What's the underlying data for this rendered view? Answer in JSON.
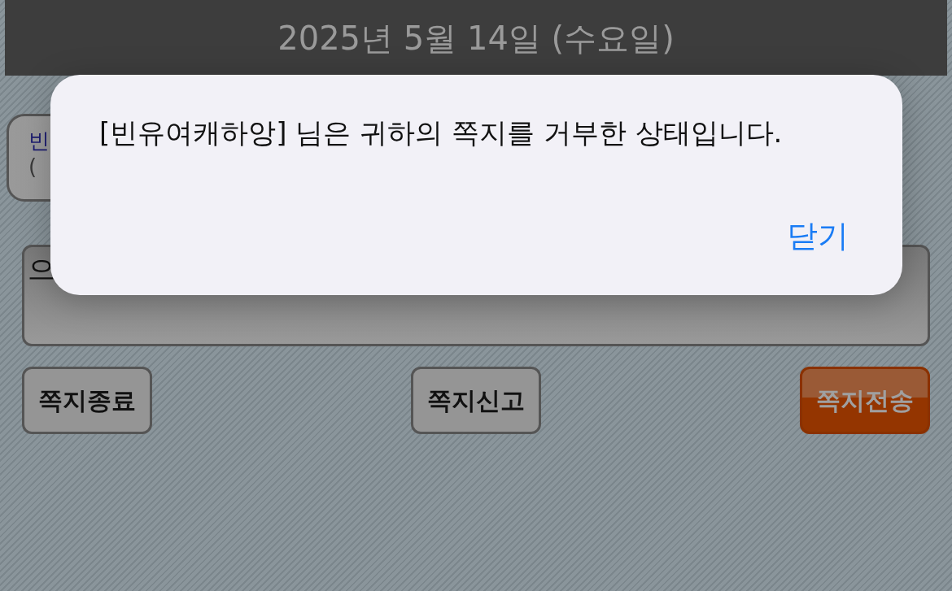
{
  "header": {
    "title": "2025년 5월 14일 (수요일)"
  },
  "profile": {
    "name": "빈",
    "detail": "("
  },
  "message_field": {
    "value": "으"
  },
  "buttons": [
    {
      "label": "쪽지종료",
      "kind": "plain"
    },
    {
      "label": "쪽지신고",
      "kind": "plain"
    },
    {
      "label": "쪽지전송",
      "kind": "primary"
    }
  ],
  "dialog": {
    "message": "[빈유여캐하앙] 님은 귀하의 쪽지를 거부한 상태입니다.",
    "close": "닫기"
  }
}
